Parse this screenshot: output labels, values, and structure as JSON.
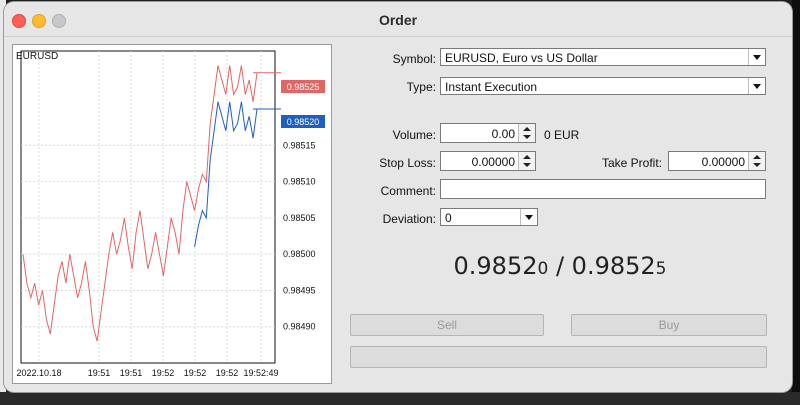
{
  "window": {
    "title": "Order"
  },
  "chart": {
    "symbol": "EURUSD",
    "y_ticks": [
      "0.98515",
      "0.98510",
      "0.98505",
      "0.98500",
      "0.98495",
      "0.98490"
    ],
    "ask_label": "0.98525",
    "bid_label": "0.98520",
    "x_ticks": [
      "2022.10.18",
      "19:51",
      "19:51",
      "19:52",
      "19:52",
      "19:52",
      "19:52:49"
    ],
    "colors": {
      "ask": "#e06666",
      "bid": "#1f5fbf",
      "grid": "#d8d8d8"
    }
  },
  "form": {
    "symbol_label": "Symbol:",
    "symbol_value": "EURUSD, Euro vs US Dollar",
    "type_label": "Type:",
    "type_value": "Instant Execution",
    "volume_label": "Volume:",
    "volume_value": "0.00",
    "volume_unit": "0 EUR",
    "stoploss_label": "Stop Loss:",
    "stoploss_value": "0.00000",
    "takeprofit_label": "Take Profit:",
    "takeprofit_value": "0.00000",
    "comment_label": "Comment:",
    "comment_value": "",
    "deviation_label": "Deviation:",
    "deviation_value": "0"
  },
  "quote": {
    "bid_main": "0.9852",
    "bid_small": "0",
    "separator": " / ",
    "ask_main": "0.9852",
    "ask_small": "5"
  },
  "buttons": {
    "sell": "Sell",
    "buy": "Buy"
  }
}
